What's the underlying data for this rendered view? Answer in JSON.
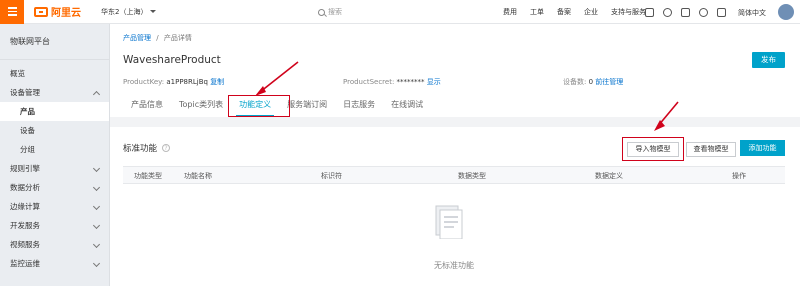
{
  "topbar": {
    "logo_text": "阿里云",
    "region": "华东2（上海）",
    "search_placeholder": "搜索",
    "links": [
      "费用",
      "工单",
      "备案",
      "企业",
      "支持与服务"
    ],
    "language": "简体中文"
  },
  "sidebar": {
    "title": "物联网平台",
    "items": [
      {
        "label": "概览"
      },
      {
        "label": "设备管理"
      },
      {
        "label": "产品"
      },
      {
        "label": "设备"
      },
      {
        "label": "分组"
      },
      {
        "label": "规则引擎"
      },
      {
        "label": "数据分析"
      },
      {
        "label": "边缘计算"
      },
      {
        "label": "开发服务"
      },
      {
        "label": "视频服务"
      },
      {
        "label": "监控运维"
      }
    ]
  },
  "header": {
    "breadcrumb": [
      "产品管理",
      "/",
      "产品详情"
    ],
    "title": "WaveshareProduct",
    "publish_label": "发布",
    "product_key_label": "ProductKey:",
    "product_key_value": "a1PP8RLjBq",
    "copy_label": "复制",
    "product_secret_label": "ProductSecret:",
    "product_secret_value": "********",
    "show_label": "显示",
    "device_count_label": "设备数:",
    "device_count_value": "0",
    "manage_label": "前往管理",
    "tabs": [
      "产品信息",
      "Topic类列表",
      "功能定义",
      "服务端订阅",
      "日志服务",
      "在线调试"
    ]
  },
  "functions": {
    "section_title": "标准功能",
    "help_glyph": "?",
    "import_label": "导入物模型",
    "view_label": "查看物模型",
    "add_label": "添加功能",
    "columns": [
      "功能类型",
      "功能名称",
      "标识符",
      "数据类型",
      "数据定义",
      "操作"
    ],
    "empty_text": "无标准功能"
  },
  "colors": {
    "brand_orange": "#ff6a00",
    "accent_blue": "#00a2ca",
    "annotation_red": "#d0021b"
  }
}
